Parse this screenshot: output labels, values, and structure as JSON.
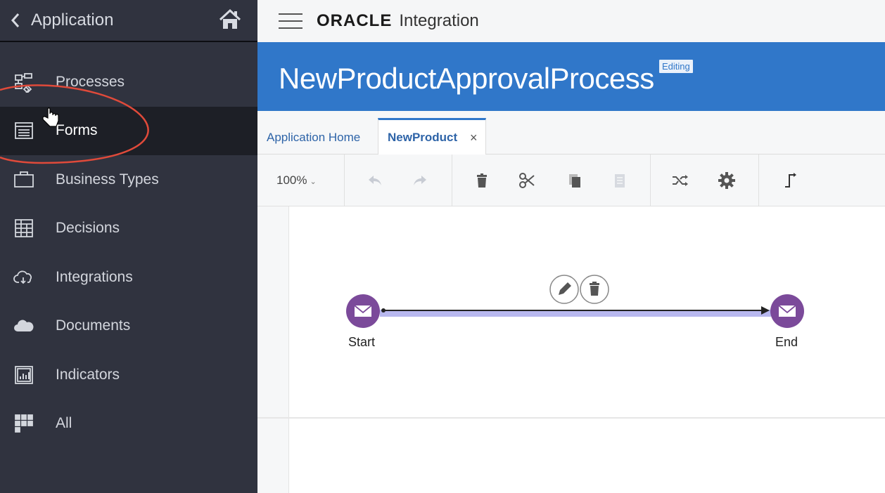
{
  "sidebar": {
    "title": "Application",
    "items": [
      {
        "label": "Processes",
        "icon": "processes-icon",
        "active": false
      },
      {
        "label": "Forms",
        "icon": "forms-icon",
        "active": true
      },
      {
        "label": "Business Types",
        "icon": "briefcase-icon",
        "active": false
      },
      {
        "label": "Decisions",
        "icon": "decision-table-icon",
        "active": false
      },
      {
        "label": "Integrations",
        "icon": "cloud-integration-icon",
        "active": false
      },
      {
        "label": "Documents",
        "icon": "cloud-documents-icon",
        "active": false
      },
      {
        "label": "Indicators",
        "icon": "indicators-icon",
        "active": false
      },
      {
        "label": "All",
        "icon": "grid-icon",
        "active": false
      }
    ]
  },
  "header": {
    "brand": "ORACLE",
    "product": "Integration"
  },
  "process": {
    "title": "NewProductApprovalProcess",
    "status_badge": "Editing"
  },
  "tabs": {
    "home_label": "Application Home",
    "active_label": "NewProduct",
    "close_glyph": "×"
  },
  "toolbar": {
    "zoom": "100%"
  },
  "diagram": {
    "start_label": "Start",
    "end_label": "End"
  },
  "colors": {
    "sidebar_bg": "#30333f",
    "banner_blue": "#3077c9",
    "node_purple": "#7b4a9a",
    "annotation_red": "#e04a3a"
  }
}
